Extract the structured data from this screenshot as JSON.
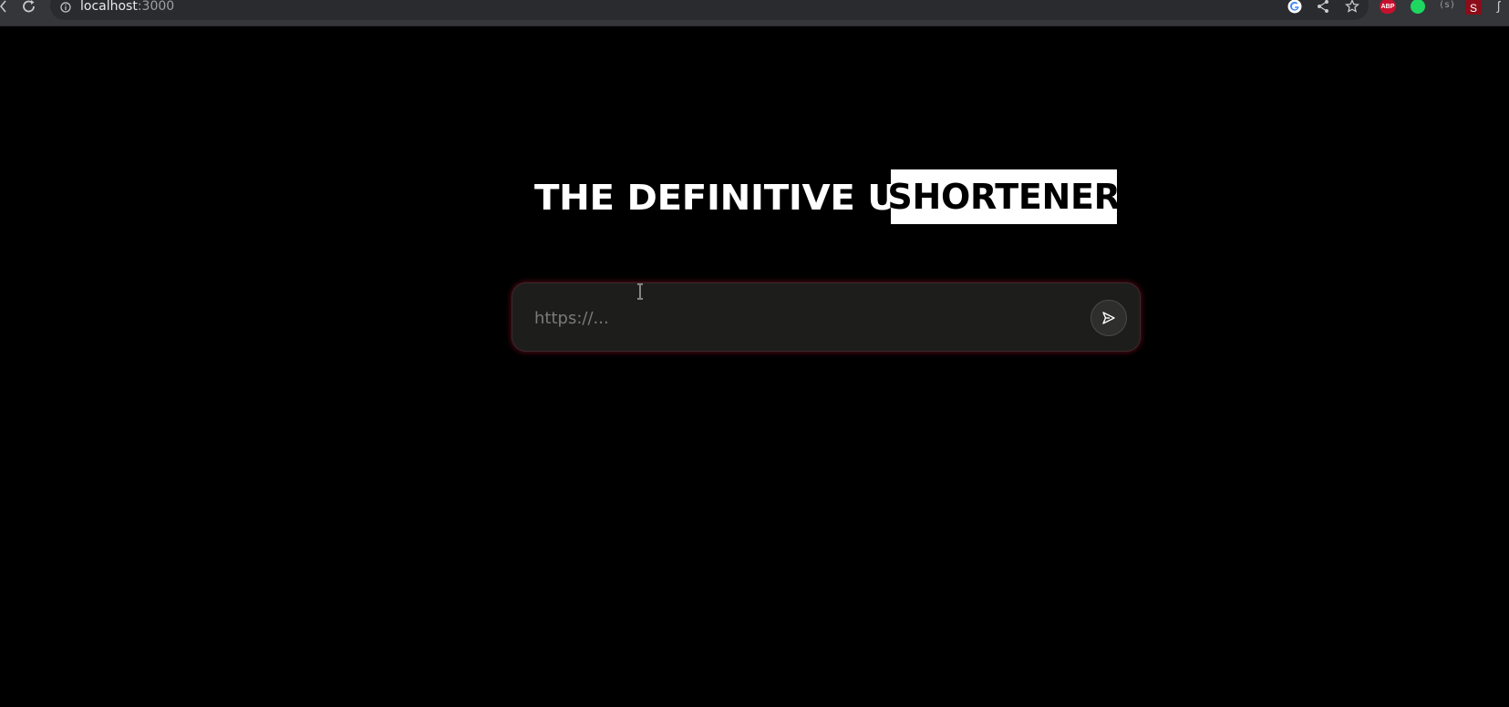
{
  "browser": {
    "url_host": "localhost",
    "url_port": ":3000",
    "icons": [
      "back-icon",
      "reload-icon",
      "site-info-icon",
      "google-icon",
      "share-icon",
      "bookmark-star-icon"
    ],
    "extensions": {
      "abp_label": "ABP",
      "gray_label": "(s)",
      "s_label": "S"
    }
  },
  "hero": {
    "title_main": "THE DEFINITIVE URL",
    "title_accent": "SHORTENER"
  },
  "form": {
    "input_value": "",
    "input_placeholder": "https://...",
    "submit_icon": "send-icon"
  },
  "colors": {
    "page_background": "#000000",
    "input_background": "#1d1d1b",
    "glow": "#96142a",
    "accent_box": "#ffffff"
  }
}
